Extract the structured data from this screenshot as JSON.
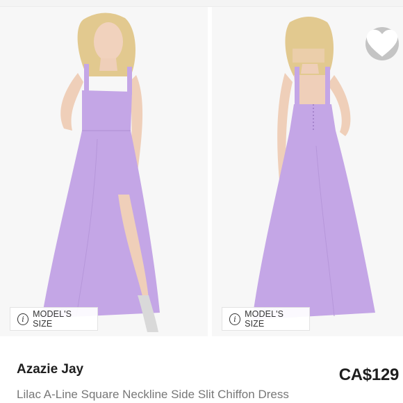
{
  "listing": {
    "brand": "Azazie Jay",
    "price": "CA$129",
    "title": "Lilac A-Line Square Neckline Side Slit Chiffon Dress"
  },
  "photos": [
    {
      "view": "front",
      "size_label": "MODEL'S SIZE",
      "icon": "info-icon"
    },
    {
      "view": "back",
      "size_label": "MODEL'S SIZE",
      "icon": "info-icon"
    }
  ],
  "favorite": {
    "icon": "heart-icon"
  },
  "colors": {
    "dress": "#c4a6e6",
    "background": "#f7f7f7",
    "favorite_button": "#c4c4c4"
  }
}
